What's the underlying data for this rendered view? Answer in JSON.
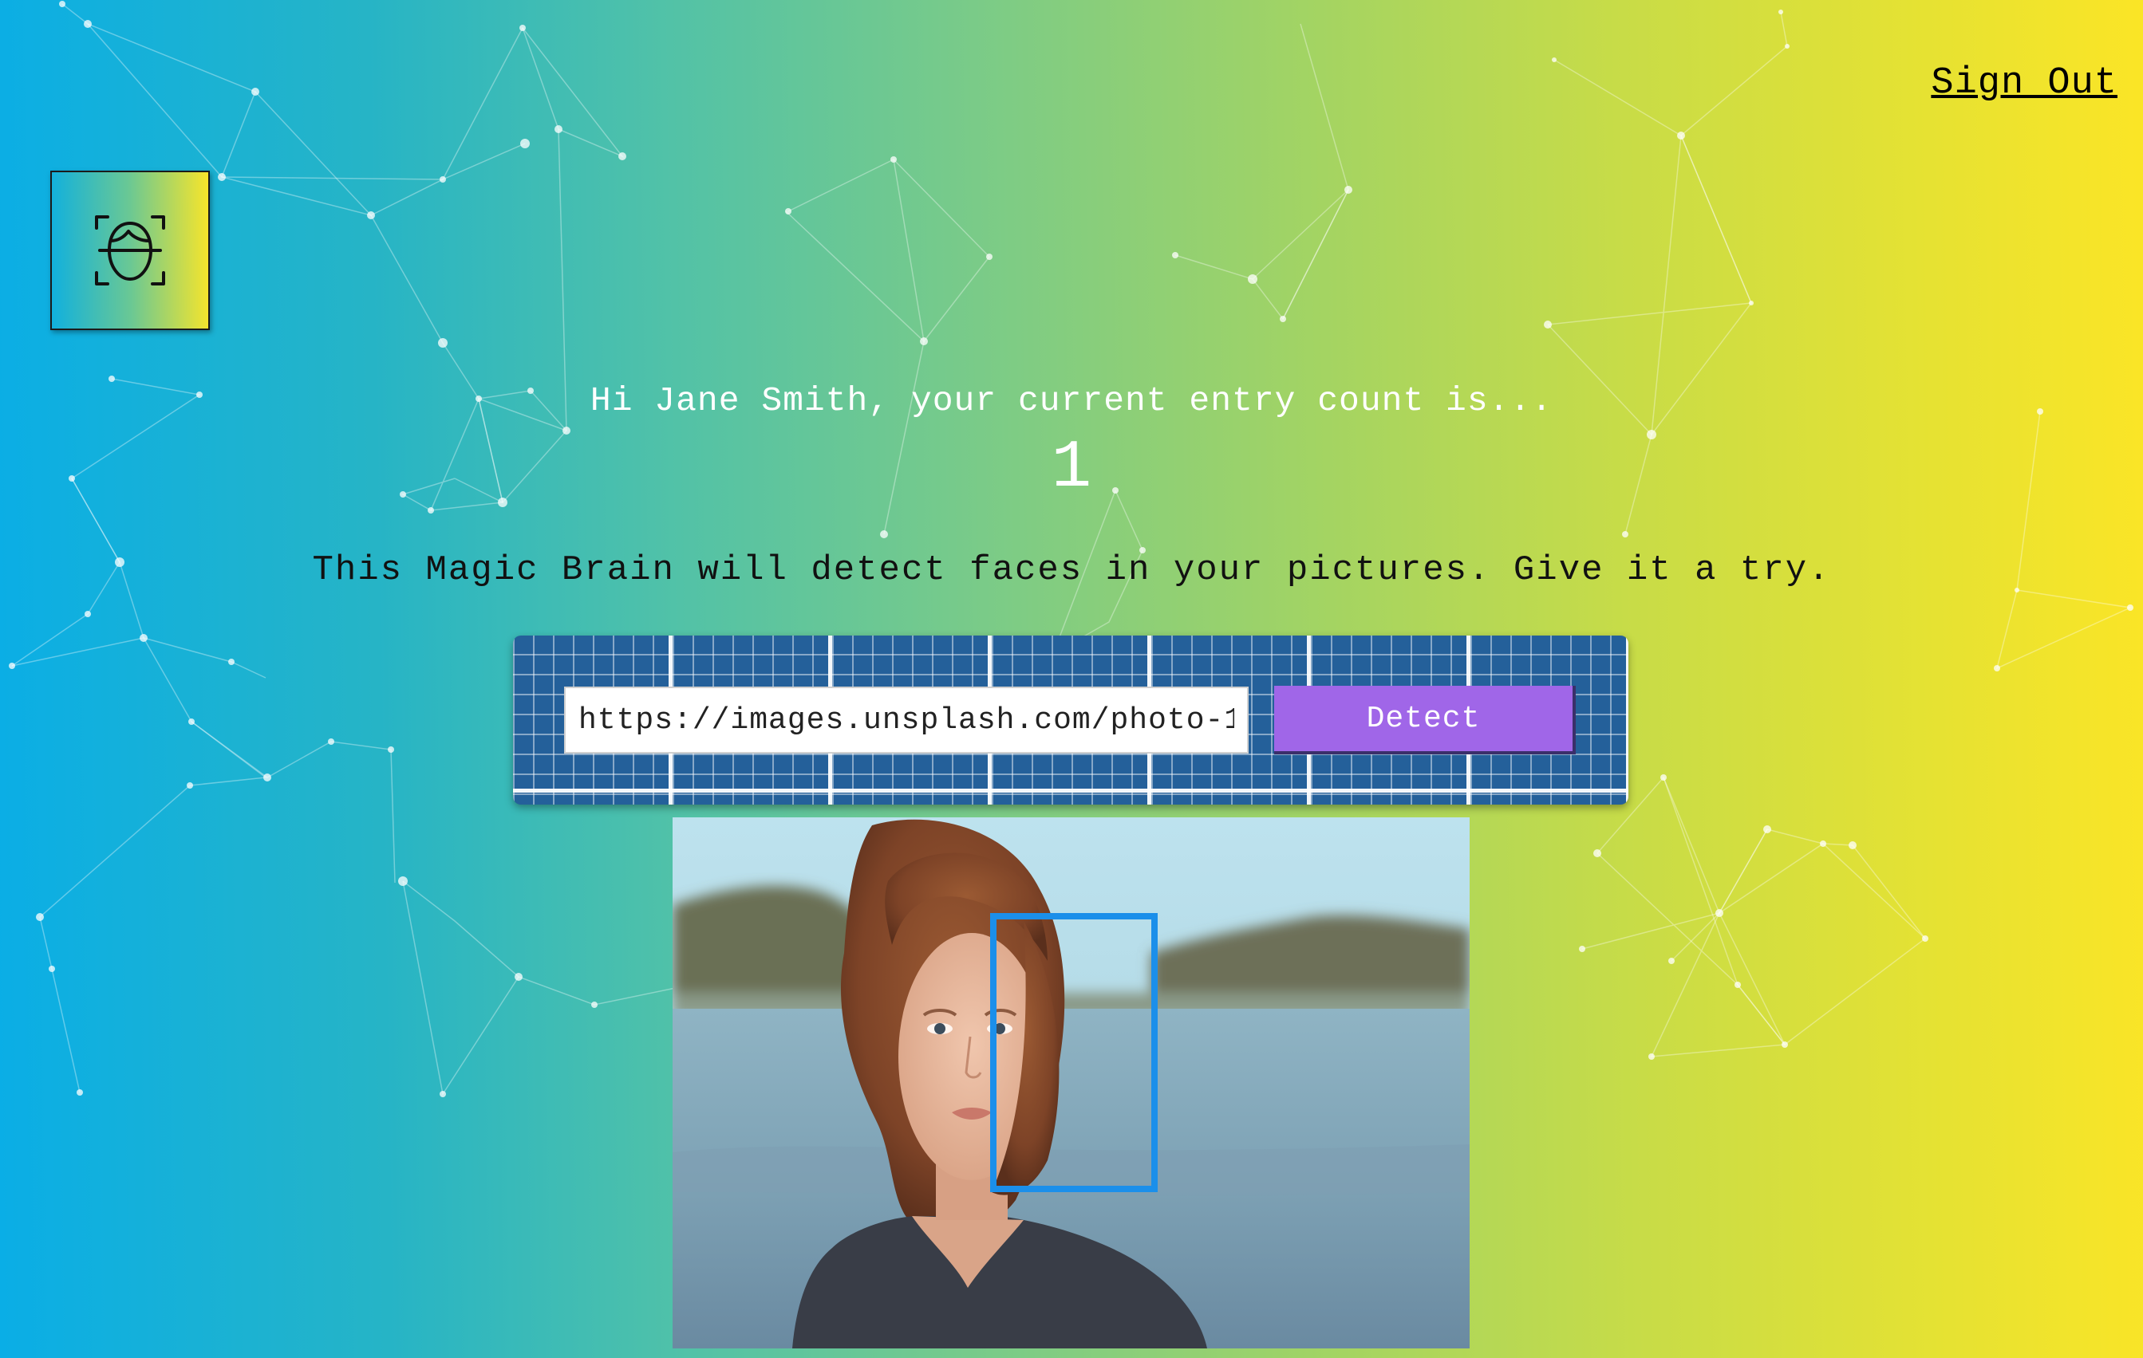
{
  "nav": {
    "sign_out_label": "Sign Out"
  },
  "logo": {
    "icon": "face-scan-icon"
  },
  "rank": {
    "greeting": "Hi Jane Smith, your current entry count is...",
    "entries": "1"
  },
  "intro": {
    "text": "This Magic Brain will detect faces in your pictures. Give it a try."
  },
  "image_form": {
    "url_value": "https://images.unsplash.com/photo-14",
    "detect_label": "Detect"
  },
  "result": {
    "image": "portrait-photo",
    "face_box_icon": "face-bounding-box"
  },
  "colors": {
    "gradient_start": "#0aaee6",
    "gradient_end": "#fbe526",
    "detect_button": "#a066e8",
    "form_panel": "#24609a",
    "face_box": "#1b8fea"
  }
}
